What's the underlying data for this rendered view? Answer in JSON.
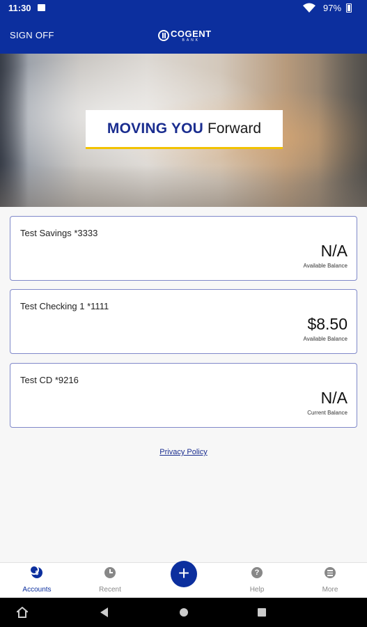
{
  "status_bar": {
    "time": "11:30",
    "battery": "97%"
  },
  "app_bar": {
    "sign_off_label": "SIGN OFF",
    "logo_name": "COGENT",
    "logo_sub": "BANK"
  },
  "hero": {
    "headline_strong": "MOVING YOU",
    "headline_light": "Forward"
  },
  "accounts": [
    {
      "name": "Test Savings *3333",
      "balance": "N/A",
      "caption": "Available Balance"
    },
    {
      "name": "Test Checking 1 *1111",
      "balance": "$8.50",
      "caption": "Available Balance"
    },
    {
      "name": "Test CD *9216",
      "balance": "N/A",
      "caption": "Current Balance"
    }
  ],
  "privacy_link": "Privacy Policy",
  "bottom_nav": {
    "items": [
      {
        "label": "Accounts",
        "icon": "accounts-icon",
        "active": true
      },
      {
        "label": "Recent",
        "icon": "clock-icon",
        "active": false
      },
      {
        "label": "Help",
        "icon": "question-icon",
        "active": false
      },
      {
        "label": "More",
        "icon": "menu-icon",
        "active": false
      }
    ],
    "fab_symbol": "+"
  },
  "colors": {
    "brand_blue": "#0c2f9e",
    "accent_yellow": "#f2c200",
    "card_border": "#7f88c9"
  }
}
